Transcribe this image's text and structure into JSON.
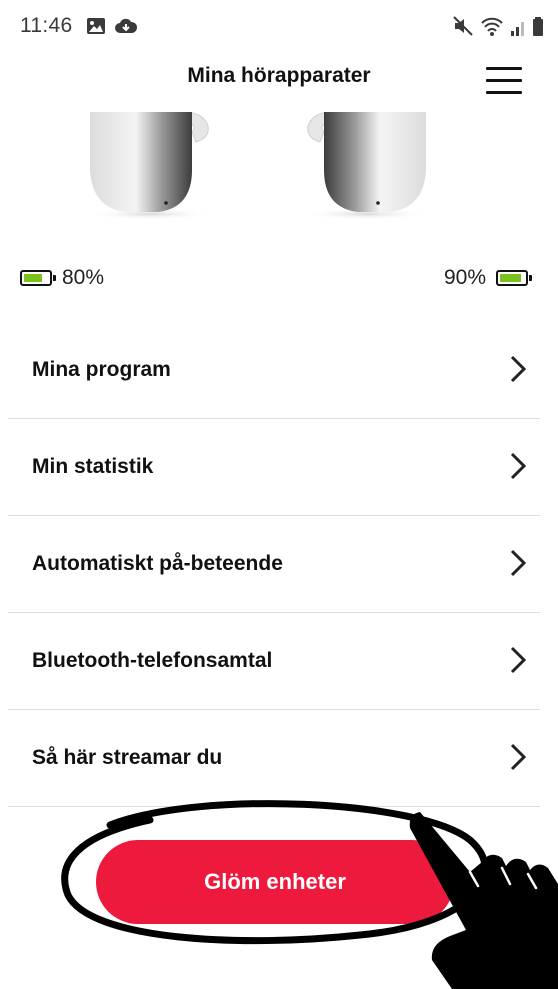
{
  "status_bar": {
    "time": "11:46",
    "left_icons": [
      "image-icon",
      "cloud-icon"
    ],
    "right_icons": [
      "mute-icon",
      "wifi-icon",
      "signal-icon",
      "battery-icon"
    ]
  },
  "header": {
    "title": "Mina hörapparater",
    "menu_icon": "hamburger-menu-icon"
  },
  "devices": {
    "left": {
      "battery_label": "80%",
      "battery_level": 0.8
    },
    "right": {
      "battery_label": "90%",
      "battery_level": 0.9
    }
  },
  "menu_items": [
    {
      "label": "Mina program"
    },
    {
      "label": "Min statistik"
    },
    {
      "label": "Automatiskt på-beteende"
    },
    {
      "label": "Bluetooth-telefonsamtal"
    },
    {
      "label": "Så här streamar du"
    }
  ],
  "actions": {
    "forget_devices_label": "Glöm enheter"
  },
  "colors": {
    "accent": "#ee1a3e",
    "battery_fill": "#7cc21f",
    "divider": "#dddddd"
  }
}
